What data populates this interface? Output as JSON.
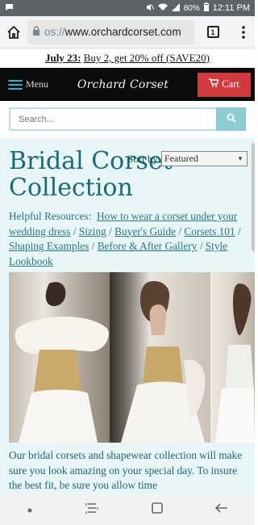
{
  "status_bar": {
    "time": "12:11 PM",
    "battery": "80%",
    "icons": [
      "message-icon",
      "mute-icon",
      "wifi-icon",
      "signal-icon",
      "battery-icon"
    ]
  },
  "browser": {
    "url_scheme": "os://",
    "url_host": "www.orchardcorset.com",
    "tab_count": "1",
    "icons": [
      "home-icon",
      "lock-icon",
      "tabs-icon",
      "overflow-menu-icon"
    ]
  },
  "promo": {
    "date": "July 23:",
    "offer": "Buy 2, get 20% off (SAVE20)"
  },
  "header": {
    "menu_label": "Menu",
    "logo_text": "Orchard Corset",
    "cart_label": "Cart",
    "colors": {
      "bar": "#0c0c0c",
      "cart": "#d13a3f",
      "hamburger": "#2ab3d0"
    }
  },
  "search": {
    "placeholder": "Search..."
  },
  "sort": {
    "label": "Sort by",
    "selected": "Featured"
  },
  "page": {
    "title": "Bridal Corset Collection",
    "resources_label": "Helpful Resources:",
    "resource_links": [
      "How to wear a corset under your wedding dress",
      "Sizing",
      "Buyer's Guide",
      "Corsets 101",
      "Shaping Examples",
      "Before & After Gallery",
      "Style Lookbook"
    ],
    "description": "Our bridal corsets and shapewear collection will make sure you look amazing on your special day. To insure the best fit, be sure you allow time"
  },
  "nav": {
    "icons": [
      "dot-icon",
      "recents-icon",
      "home-square-icon",
      "back-icon"
    ]
  },
  "colors": {
    "main_bg": "#e8f5f6",
    "heading": "#1a6b75",
    "link": "#2a7781"
  }
}
